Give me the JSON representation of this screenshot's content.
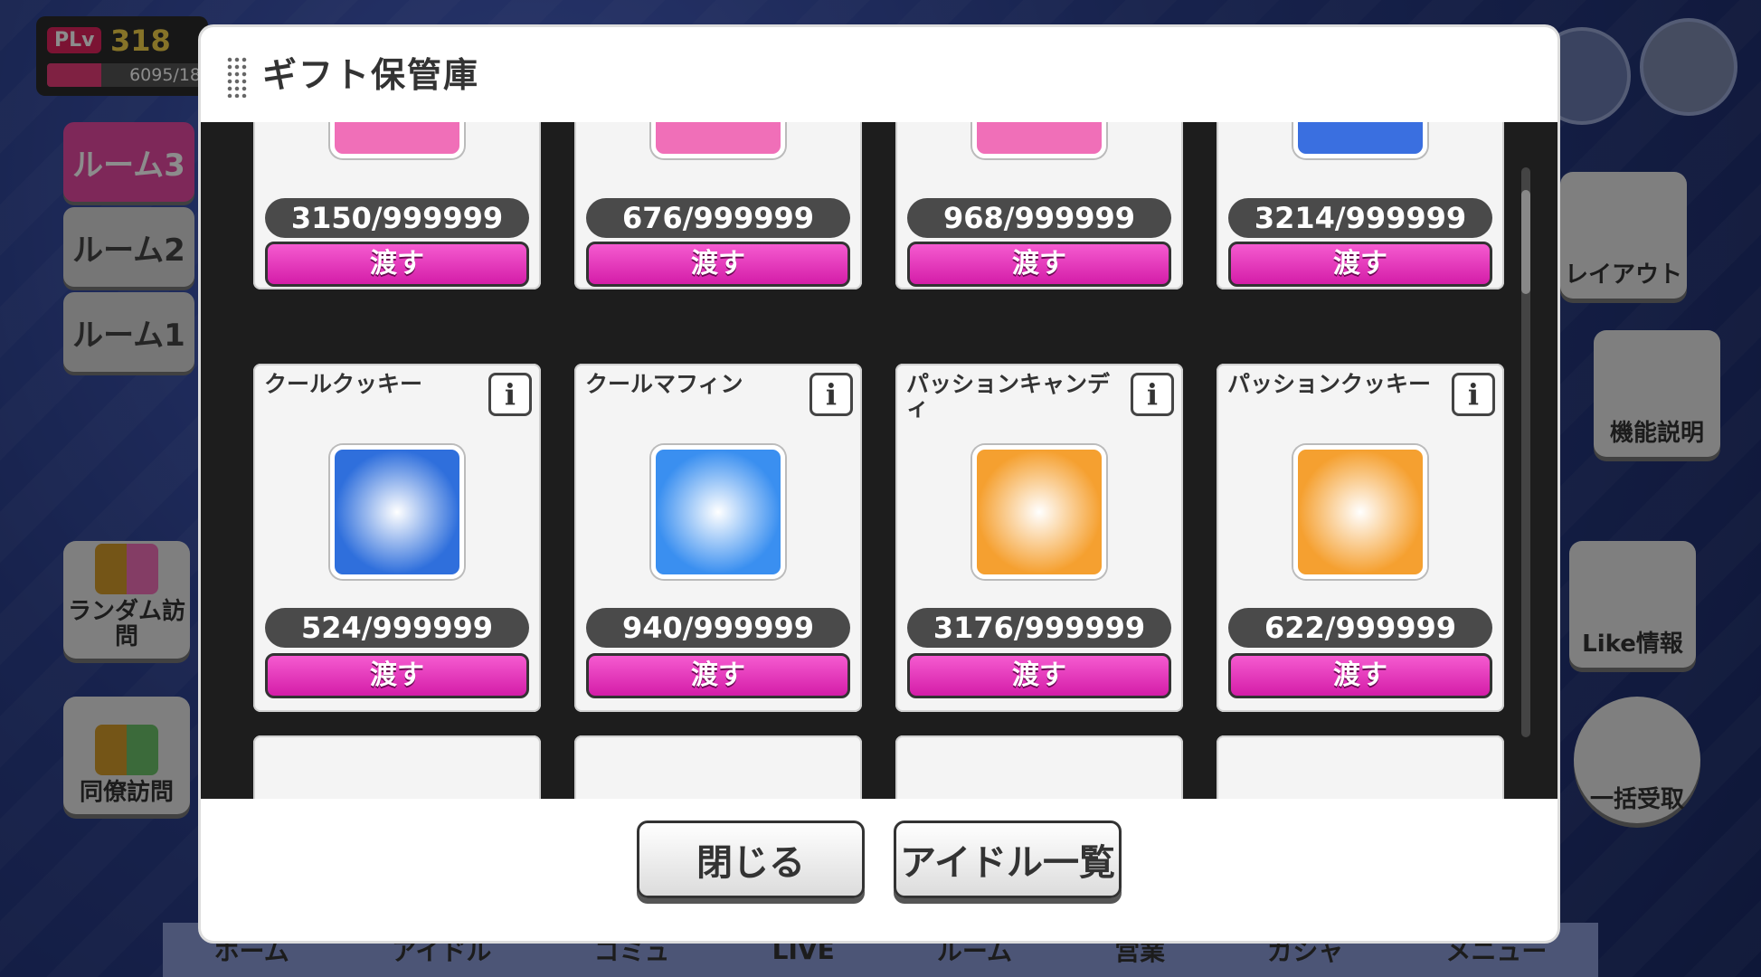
{
  "player": {
    "plv_label": "PLv",
    "level": "318",
    "exp_text": "6095/18",
    "exp_fraction": 0.35
  },
  "rooms": [
    {
      "label": "ルーム3",
      "active": true
    },
    {
      "label": "ルーム2",
      "active": false
    },
    {
      "label": "ルーム1",
      "active": false
    }
  ],
  "left_buttons": {
    "random_visit": "ランダム訪問",
    "colleague_visit": "同僚訪問"
  },
  "right_buttons": {
    "layout": "レイアウト",
    "help": "機能説明",
    "like_info": "Like情報",
    "bulk_receive": "一括受取"
  },
  "nav": [
    "ホーム",
    "アイドル",
    "コミュ",
    "LIVE",
    "ルーム",
    "営業",
    "ガシャ",
    "メニュー"
  ],
  "modal": {
    "title": "ギフト保管庫",
    "close_label": "閉じる",
    "idol_list_label": "アイドル一覧",
    "give_label": "渡す",
    "info_label": "i",
    "top_row": [
      {
        "count": "3150/999999",
        "color": "#f06fb8"
      },
      {
        "count": "676/999999",
        "color": "#f06fb8"
      },
      {
        "count": "968/999999",
        "color": "#f06fb8"
      },
      {
        "count": "3214/999999",
        "color": "#3a6fe0"
      }
    ],
    "items": [
      {
        "name": "クールクッキー",
        "count": "524/999999",
        "color": "#2f6fdc",
        "icon": "cookie-icon"
      },
      {
        "name": "クールマフィン",
        "count": "940/999999",
        "color": "#3a8ff0",
        "icon": "muffin-icon"
      },
      {
        "name": "パッションキャンディ",
        "count": "3176/999999",
        "color": "#f5a030",
        "icon": "candy-icon"
      },
      {
        "name": "パッションクッキー",
        "count": "622/999999",
        "color": "#f5a030",
        "icon": "cookie-icon"
      }
    ]
  }
}
